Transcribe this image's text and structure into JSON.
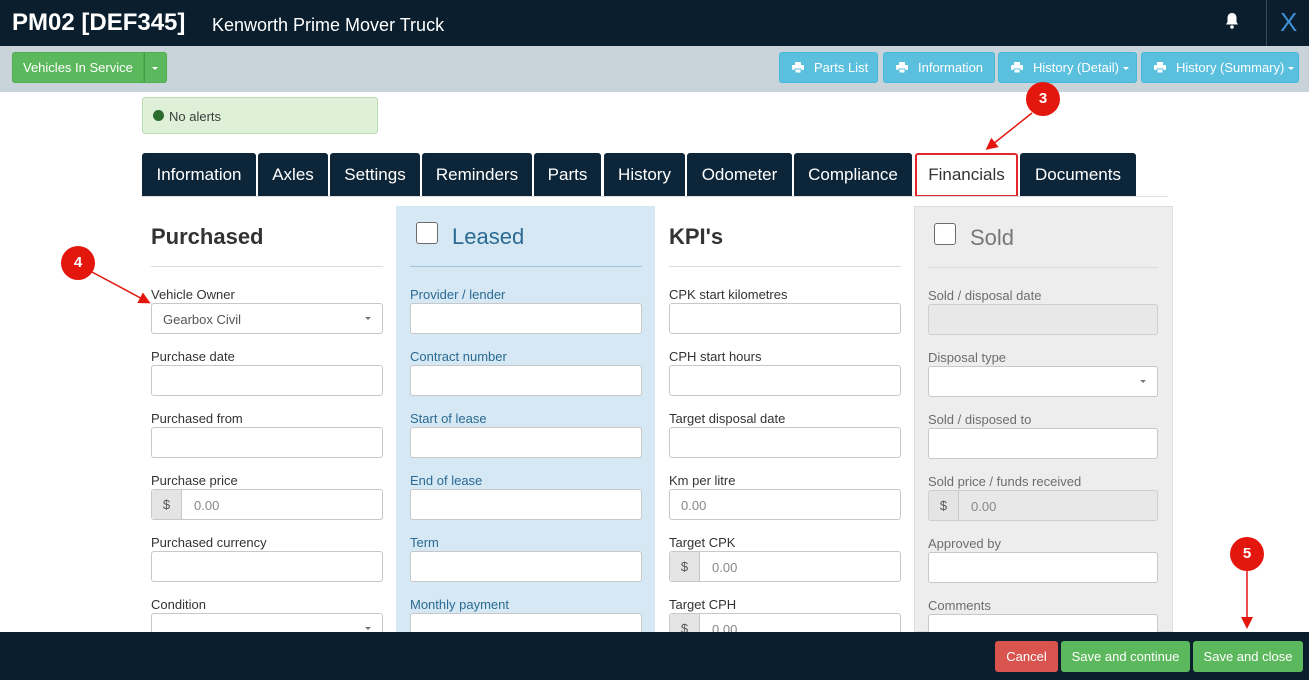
{
  "title": {
    "code": "PM02 [DEF345]",
    "subtitle": "Kenworth Prime Mover Truck",
    "close_label": "X"
  },
  "toolbar": {
    "status_button": "Vehicles In Service",
    "parts_list": "Parts List",
    "information": "Information",
    "history_detail": "History (Detail)",
    "history_summary": "History (Summary)"
  },
  "alert": {
    "text": "No alerts"
  },
  "tabs": [
    "Information",
    "Axles",
    "Settings",
    "Reminders",
    "Parts",
    "History",
    "Odometer",
    "Compliance",
    "Financials",
    "Documents"
  ],
  "active_tab": "Financials",
  "purchased": {
    "heading": "Purchased",
    "vehicle_owner_label": "Vehicle Owner",
    "vehicle_owner_value": "Gearbox Civil",
    "purchase_date_label": "Purchase date",
    "purchased_from_label": "Purchased from",
    "purchase_price_label": "Purchase price",
    "purchase_price_prefix": "$",
    "purchase_price_placeholder": "0.00",
    "purchased_currency_label": "Purchased currency",
    "condition_label": "Condition"
  },
  "leased": {
    "heading": "Leased",
    "provider_label": "Provider / lender",
    "contract_label": "Contract number",
    "start_label": "Start of lease",
    "end_label": "End of lease",
    "term_label": "Term",
    "monthly_label": "Monthly payment"
  },
  "kpis": {
    "heading": "KPI's",
    "cpk_start_label": "CPK start kilometres",
    "cph_start_label": "CPH start hours",
    "target_disposal_label": "Target disposal date",
    "km_per_litre_label": "Km per litre",
    "km_per_litre_placeholder": "0.00",
    "target_cpk_label": "Target CPK",
    "target_cpk_prefix": "$",
    "target_cpk_placeholder": "0.00",
    "target_cph_label": "Target CPH",
    "target_cph_prefix": "$",
    "target_cph_placeholder": "0.00"
  },
  "sold": {
    "heading": "Sold",
    "disposal_date_label": "Sold / disposal date",
    "disposal_type_label": "Disposal type",
    "disposed_to_label": "Sold / disposed to",
    "sold_price_label": "Sold price / funds received",
    "sold_price_prefix": "$",
    "sold_price_placeholder": "0.00",
    "approved_by_label": "Approved by",
    "comments_label": "Comments"
  },
  "footer": {
    "cancel": "Cancel",
    "save_continue": "Save and continue",
    "save_close": "Save and close"
  },
  "markers": {
    "m3": "3",
    "m4": "4",
    "m5": "5"
  },
  "colors": {
    "brand_dark": "#0a1e2d",
    "success": "#5cb85c",
    "info": "#5bc0de",
    "danger": "#d9534f",
    "annotation": "#e3170e"
  }
}
